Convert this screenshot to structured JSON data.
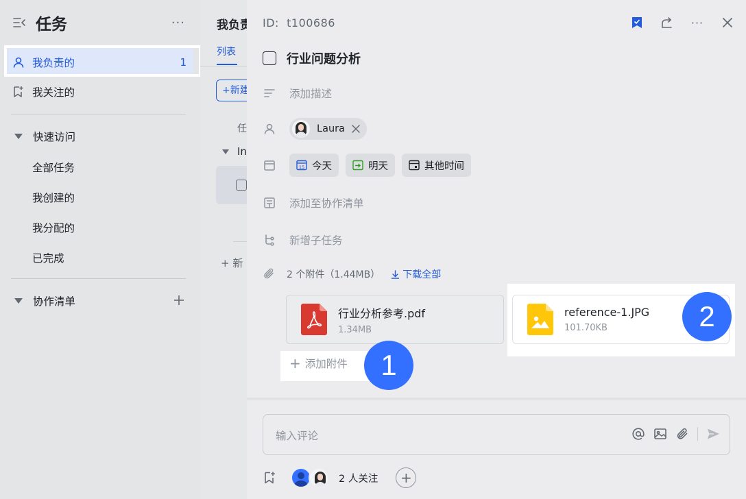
{
  "sidebar": {
    "title": "任务",
    "items": [
      {
        "label": "我负责的",
        "count": "1"
      },
      {
        "label": "我关注的"
      }
    ],
    "quick_access": {
      "label": "快速访问",
      "items": [
        "全部任务",
        "我创建的",
        "我分配的",
        "已完成"
      ]
    },
    "collab": {
      "label": "协作清单"
    }
  },
  "middle": {
    "title": "我负责",
    "tab": "列表",
    "new_button": "新建",
    "column": "任",
    "group": "In",
    "add_row": "新"
  },
  "detail": {
    "id_label": "ID:",
    "id_value": "t100686",
    "task_title": "行业问题分析",
    "description_placeholder": "添加描述",
    "assignee": "Laura",
    "dates": [
      "今天",
      "明天",
      "其他时间"
    ],
    "date_day_number": "15",
    "add_to_list": "添加至协作清单",
    "add_subtask": "新增子任务",
    "attachments_summary": "2 个附件（1.44MB）",
    "download_all": "下载全部",
    "files": [
      {
        "name": "行业分析参考.pdf",
        "size": "1.34MB",
        "type": "pdf"
      },
      {
        "name": "reference-1.JPG",
        "size": "101.70KB",
        "type": "image"
      }
    ],
    "add_attachment": "添加附件",
    "comment_placeholder": "输入评论",
    "followers_text": "2 人关注"
  },
  "callouts": [
    "1",
    "2"
  ],
  "colors": {
    "accent": "#245bdb",
    "badge": "#3370ff",
    "pdf": "#d83931",
    "image": "#ffc60a"
  }
}
